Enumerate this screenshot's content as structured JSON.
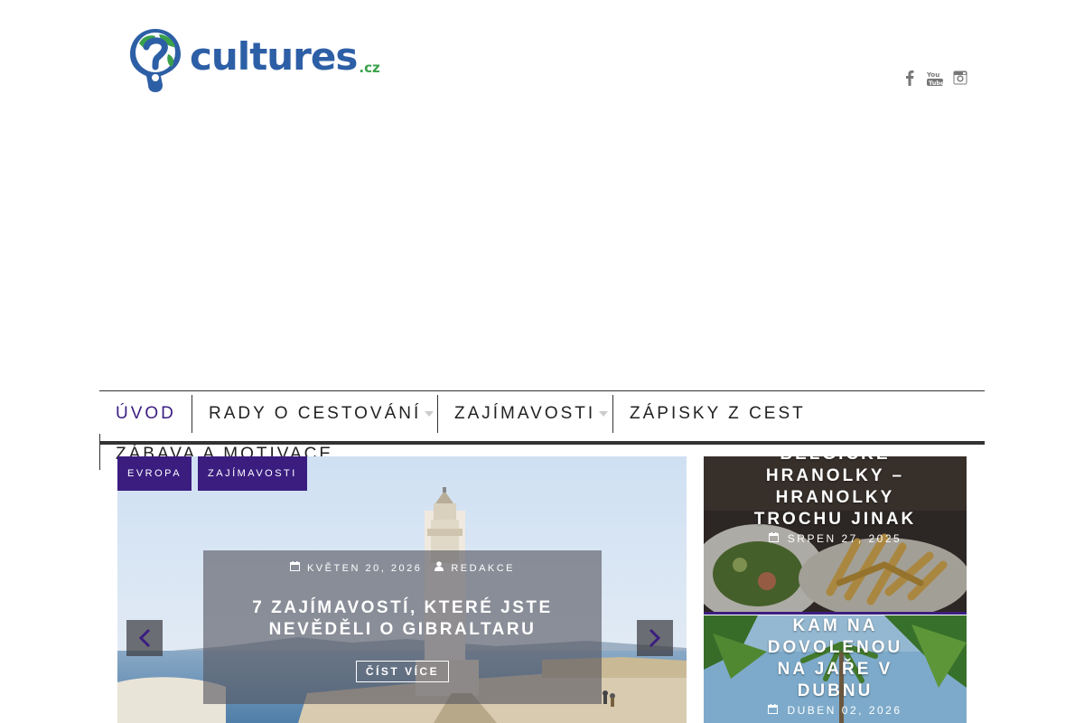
{
  "brand": {
    "name": "cultures",
    "tld": ".cz",
    "primary_color": "#2d5fa6",
    "accent_color": "#3aa14a"
  },
  "social": [
    {
      "name": "facebook-icon"
    },
    {
      "name": "youtube-icon"
    },
    {
      "name": "instagram-icon"
    }
  ],
  "nav": {
    "items": [
      {
        "label": "ÚVOD",
        "active": true
      },
      {
        "label": "RADY O CESTOVÁNÍ",
        "has_submenu": true
      },
      {
        "label": "ZAJÍMAVOSTI",
        "has_submenu": true
      },
      {
        "label": "ZÁPISKY Z CEST"
      },
      {
        "label": "ZÁBAVA A MOTIVACE"
      }
    ],
    "active_color": "#3b1d80"
  },
  "slider": {
    "tags": [
      "EVROPA",
      "ZAJÍMAVOSTI"
    ],
    "date": "KVĚTEN 20, 2026",
    "author": "REDAKCE",
    "title": "7 ZAJÍMAVOSTÍ, KTERÉ JSTE NEVĚDĚLI O GIBRALTARU",
    "read_more": "ČÍST VÍCE",
    "tag_color": "#3b1d80"
  },
  "side_posts": [
    {
      "title": "BELGICKÉ HRANOLKY – HRANOLKY TROCHU JINAK",
      "date": "SRPEN 27, 2025"
    },
    {
      "title": "KAM NA DOVOLENOU NA JAŘE V DUBNU",
      "date": "DUBEN 02, 2026"
    }
  ]
}
